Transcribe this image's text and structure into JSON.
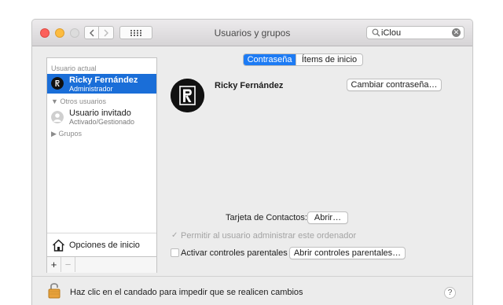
{
  "window": {
    "title": "Usuarios y grupos",
    "traffic_lights": {
      "close": "#fc605b",
      "minimize": "#fdbc40",
      "zoom": "#dcdcdc"
    }
  },
  "toolbar": {
    "back_icon": "chevron-left-icon",
    "forward_icon": "chevron-right-icon",
    "grid_icon": "grid-icon",
    "search": {
      "value": "iClou",
      "icon": "search-icon",
      "clear_icon": "clear-icon"
    }
  },
  "sidebar": {
    "current_user_label": "Usuario actual",
    "current_user": {
      "name": "Ricky Fernández",
      "role": "Administrador",
      "selected": true
    },
    "other_users_label": "Otros usuarios",
    "guest_user": {
      "name": "Usuario invitado",
      "status": "Activado/Gestionado"
    },
    "groups_label": "Grupos",
    "login_options_label": "Opciones de inicio",
    "add_label": "+",
    "remove_label": "−"
  },
  "tabs": [
    {
      "label": "Contraseña",
      "active": true
    },
    {
      "label": "Ítems de inicio",
      "active": false
    }
  ],
  "main": {
    "user_name": "Ricky Fernández",
    "change_password_label": "Cambiar contraseña…",
    "contacts_card_label": "Tarjeta de Contactos:",
    "open_label": "Abrir…",
    "allow_admin_label": "Permitir al usuario administrar este ordenador",
    "allow_admin_checked": true,
    "allow_admin_enabled": false,
    "parental_controls_label": "Activar controles parentales",
    "parental_controls_checked": false,
    "open_parental_label": "Abrir controles parentales…"
  },
  "footer": {
    "lock_text": "Haz clic en el candado para impedir que se realicen cambios",
    "help_label": "?"
  },
  "colors": {
    "accent": "#1d7bf4",
    "selection": "#1a6ed8"
  }
}
